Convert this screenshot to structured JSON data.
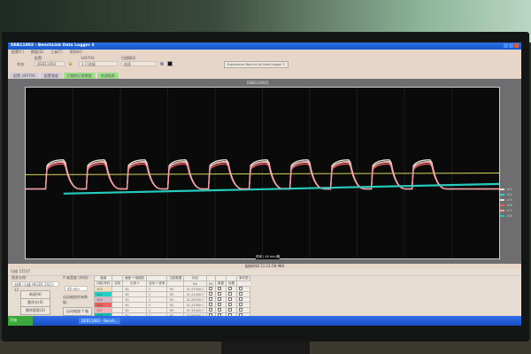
{
  "window": {
    "title": "DEB11003 - BenchLink Data Logger 3"
  },
  "menu": [
    "配置(C)",
    "数据(D)",
    "工具(T)",
    "帮助(H)"
  ],
  "toolbar": {
    "config_label": "配置:",
    "config_value": "DEB11003",
    "state_label": "状态:",
    "instrument_label": "34970A",
    "instrument_value": "1 已连接",
    "scan_label": "扫描模式:",
    "scan_value": "连续",
    "about_button": "Experience BenchLink Data Logger 3"
  },
  "tabs": [
    "配置 34970A",
    "配置通道",
    "扫描和记录数据",
    "快速图表"
  ],
  "chart": {
    "title": "[DEB11003]",
    "xlabel": "时间 | 40 min/格",
    "start_label": "起始时间",
    "start_time": "11:11:59.984"
  },
  "chart_data": {
    "type": "line",
    "ylim": [
      0,
      60
    ],
    "xlim": [
      0,
      50
    ],
    "series": [
      {
        "name": "103",
        "color": "#f2e6d0",
        "pulse": true,
        "low": 24.4,
        "high": 34.6
      },
      {
        "name": "104",
        "color": "#2ad4c8",
        "pulse": false,
        "start": 22.9,
        "end": 26.3
      },
      {
        "name": "105",
        "color": "#e0e0e0",
        "pulse": true,
        "low": 24.4,
        "high": 34.0
      },
      {
        "name": "106",
        "color": "#e85a5a",
        "pulse": true,
        "low": 24.4,
        "high": 33.2
      },
      {
        "name": "107",
        "color": "#f5a0a8",
        "pulse": true,
        "low": 24.4,
        "high": 33.8
      },
      {
        "name": "108",
        "color": "#20c8b8",
        "pulse": false,
        "start": 22.6,
        "end": 26.0
      }
    ],
    "limit_line": {
      "color": "#d8d860",
      "start": 29.4,
      "end": 30.0
    },
    "cycles": 10
  },
  "lower": {
    "header": "扫描  15537",
    "chart_label": "图表名称:",
    "chart_select": "创建 (1)器 INGER 2021-12",
    "buttons": [
      "新建(N)",
      "重命名(R)",
      "删除图表(D)"
    ],
    "xaxis_label": "X 轴宽度 (时间):",
    "xaxis_value": "40 min",
    "autoscale_label": "自动缩放所有数据:",
    "autoscale_button": "自动缩放 Y 轴",
    "table_headers": [
      "通道",
      "",
      "偏差 Y 轴缩放",
      "",
      "当前数据",
      "标记",
      "",
      "",
      "",
      "事件图"
    ],
    "sub_headers": [
      "功能/号码",
      "名称",
      "比例 Y",
      "自动 Y 参考",
      "",
      "M1",
      "M2",
      "数据",
      "设置"
    ],
    "rows": [
      {
        "ch": "103",
        "color": "#f3e0c0",
        "scale": "30",
        "unit": "C",
        "ref": "50",
        "value": "21.47300 C"
      },
      {
        "ch": "104",
        "color": "#1ed6c8",
        "scale": "30",
        "unit": "C",
        "ref": "50",
        "value": "21.41400 C"
      },
      {
        "ch": "105",
        "color": "#d8b8c8",
        "scale": "30",
        "unit": "C",
        "ref": "50",
        "value": "21.29100 C"
      },
      {
        "ch": "106",
        "color": "#f06060",
        "scale": "30",
        "unit": "C",
        "ref": "50",
        "value": "21.31300 C"
      },
      {
        "ch": "107",
        "color": "#f8b0b8",
        "scale": "30",
        "unit": "C",
        "ref": "50",
        "value": "21.32400 C"
      },
      {
        "ch": "108",
        "color": "#18b8a8",
        "scale": "30",
        "unit": "C",
        "ref": "50",
        "value": "20.99300 C"
      }
    ]
  },
  "taskbar": {
    "start": "开始",
    "task": "DEB11003 - Bench..."
  }
}
